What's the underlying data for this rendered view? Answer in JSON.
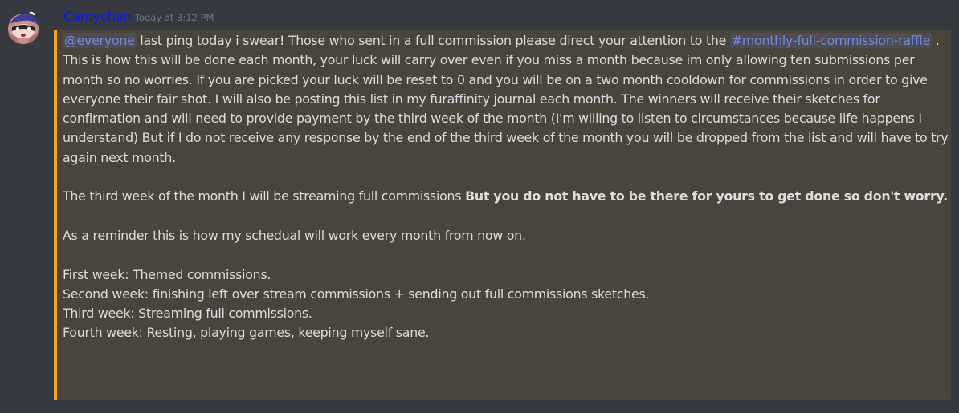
{
  "message": {
    "author": "Camychan",
    "timestamp": "Today at 3:12 PM",
    "colors": {
      "author": "#0b17f2",
      "mention": "#7289da",
      "highlight_bg": "#49443c",
      "highlight_border": "#faa61a",
      "text": "#dcddde",
      "background": "#36393f"
    },
    "mention_user": "@everyone",
    "mention_channel": "#monthly-full-commission-raffle",
    "p1_part1": " last ping today i swear! Those who sent in a full commission please direct your attention to the ",
    "p1_part2": " . This is how this will be done each month, your luck will carry over even if you miss a month because im only allowing ten submissions per month so no worries. If you are picked your luck will be reset to 0 and you will be on a two month cooldown for commissions in order to give everyone their fair shot. I will also be posting this list in my furaffinity journal each month. The winners will receive their sketches for confirmation and will need to provide payment by the third week of the month (I'm willing to listen to circumstances because life happens I understand) But if I do not receive any response by the end of the third week of the month you will be dropped from the list and will have to try again next month.",
    "p2_plain": "The third week of the month I will be streaming full commissions ",
    "p2_bold": "But you do not have to be there for yours to get done so don't worry.",
    "p3": "As a reminder this is how my schedual will work every month from now on.",
    "schedule": [
      "First week: Themed commissions.",
      "Second week: finishing left over stream commissions + sending out full commissions sketches.",
      "Third week: Streaming full commissions.",
      "Fourth week: Resting, playing games, keeping myself sane."
    ]
  }
}
